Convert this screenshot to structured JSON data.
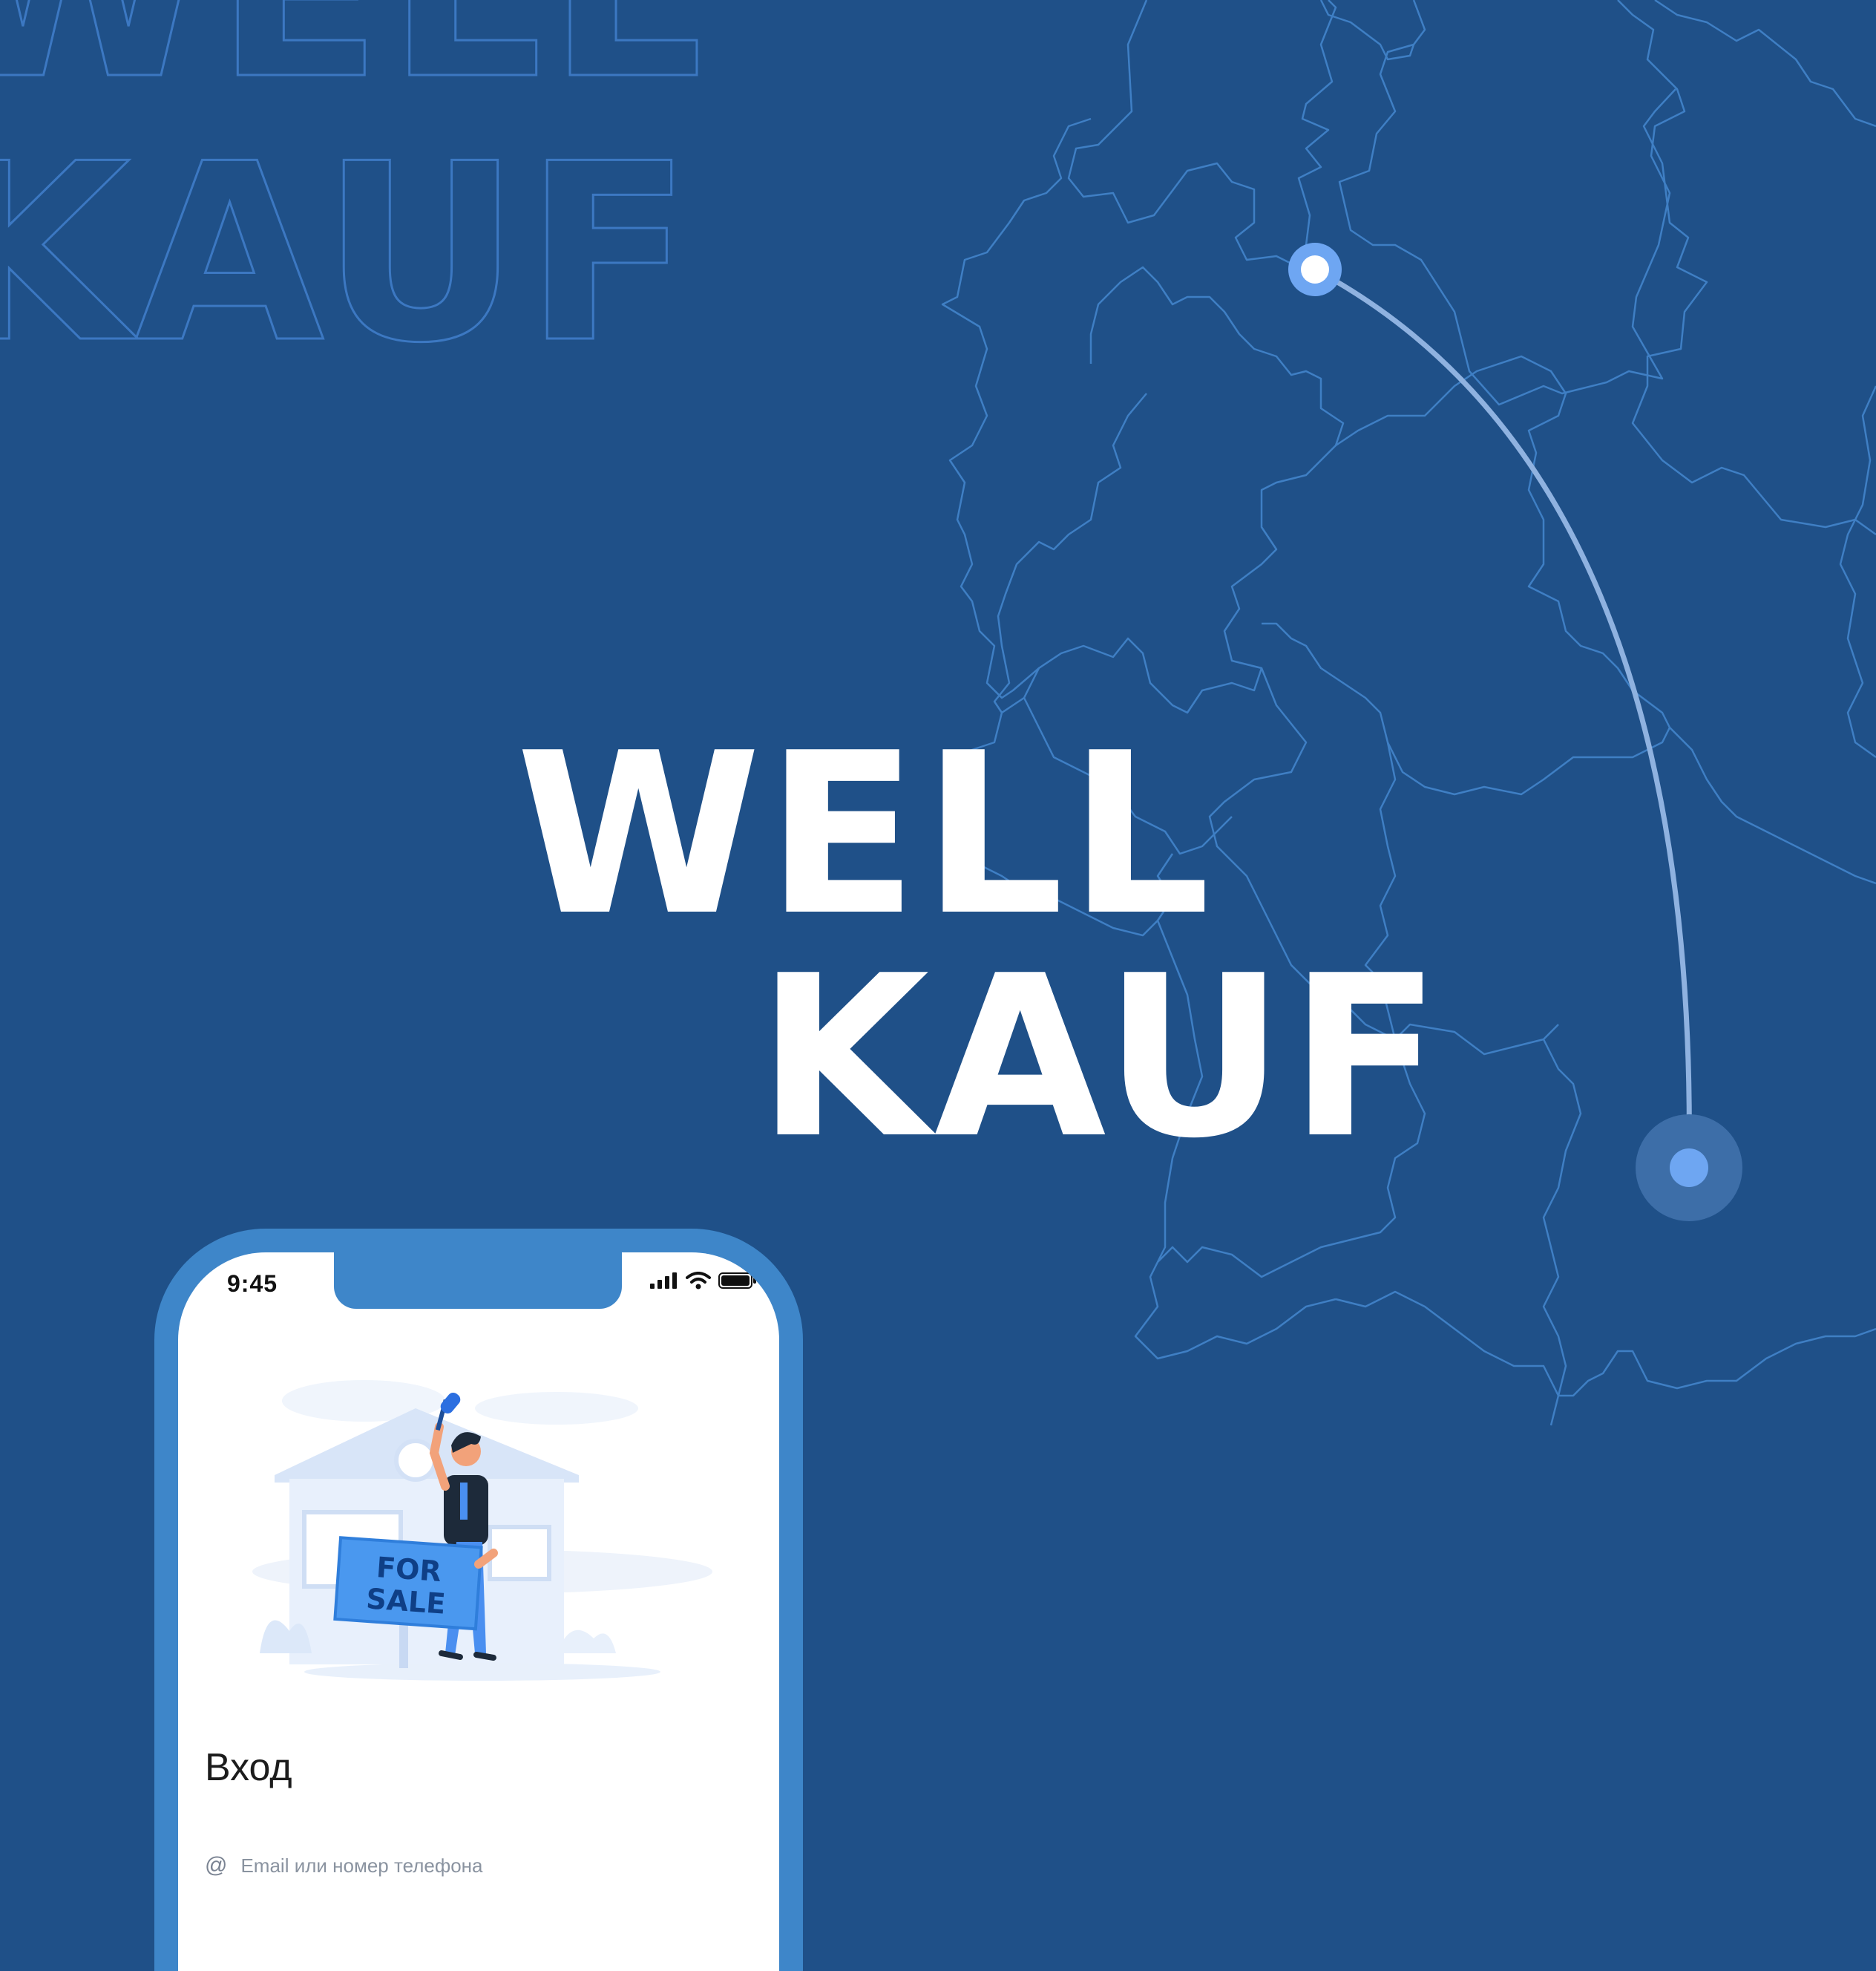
{
  "brand": {
    "title_line1": "WELL",
    "title_line2": "KAUF",
    "background_color": "#1f5088",
    "accent_color": "#6ea6f2"
  },
  "phone": {
    "status_time": "9:45",
    "status_icons": [
      "signal-bars-icon",
      "wifi-icon",
      "battery-icon"
    ],
    "illustration": {
      "sign_line1": "FOR",
      "sign_line2": "SALE"
    },
    "login": {
      "title": "Вход",
      "email_icon": "at-icon",
      "email_placeholder": "Email или номер телефона"
    }
  },
  "map": {
    "route": {
      "from_marker": "route-start-marker",
      "to_marker": "route-end-marker"
    }
  }
}
